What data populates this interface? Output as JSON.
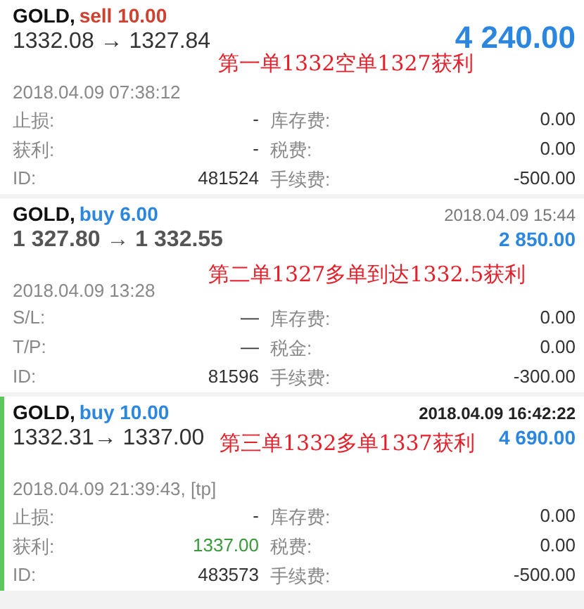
{
  "trades": [
    {
      "symbol": "GOLD,",
      "kind": "sell",
      "volume": "sell 10.00",
      "selected": false,
      "prices": "1332.08 → 1327.84",
      "profit": "4 240.00",
      "close_time": "2018.04.09 07:38:12",
      "annotation": "第一单1332空单1327获利",
      "details": [
        {
          "label": "止损:",
          "value": "-",
          "triggered": false,
          "label2": "库存费:",
          "value2": "0.00"
        },
        {
          "label": "获利:",
          "value": "-",
          "triggered": false,
          "label2": "税费:",
          "value2": "0.00"
        },
        {
          "label": "ID:",
          "value": "481524",
          "triggered": false,
          "label2": "手续费:",
          "value2": "-500.00"
        }
      ]
    },
    {
      "symbol": "GOLD,",
      "kind": "buy",
      "volume": "buy 6.00",
      "selected": false,
      "header_time": "2018.04.09 15:44",
      "prices": "1 327.80 → 1 332.55",
      "profit": "2 850.00",
      "close_time": "2018.04.09 13:28",
      "annotation": "第二单1327多单到达1332.5获利",
      "details": [
        {
          "label": "S/L:",
          "value": "—",
          "triggered": false,
          "label2": "库存费:",
          "value2": "0.00"
        },
        {
          "label": "T/P:",
          "value": "—",
          "triggered": false,
          "label2": "税金:",
          "value2": "0.00"
        },
        {
          "label": "ID:",
          "value": "81596",
          "triggered": false,
          "label2": "手续费:",
          "value2": "-300.00"
        }
      ]
    },
    {
      "symbol": "GOLD,",
      "kind": "buy",
      "volume": "buy 10.00",
      "selected": true,
      "header_time": "2018.04.09 16:42:22",
      "prices": "1332.31→ 1337.00",
      "profit": "4 690.00",
      "close_time": "2018.04.09 21:39:43, [tp]",
      "annotation": "第三单1332多单1337获利",
      "details": [
        {
          "label": "止损:",
          "value": "-",
          "triggered": false,
          "label2": "库存费:",
          "value2": "0.00"
        },
        {
          "label": "获利:",
          "value": "1337.00",
          "triggered": true,
          "label2": "税费:",
          "value2": "0.00"
        },
        {
          "label": "ID:",
          "value": "483573",
          "triggered": false,
          "label2": "手续费:",
          "value2": "-500.00"
        }
      ]
    }
  ]
}
